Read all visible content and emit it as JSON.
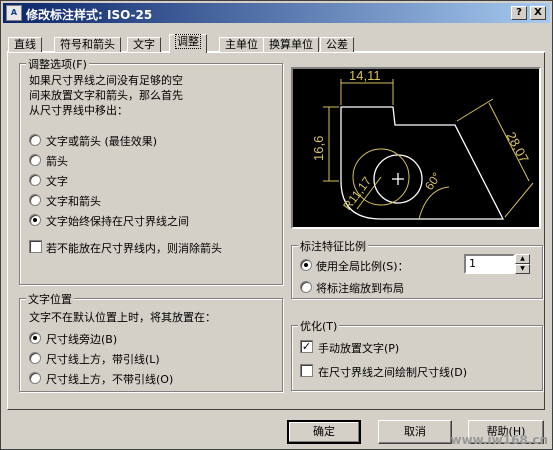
{
  "window": {
    "title": "修改标注样式: ISO-25",
    "help_btn": "?",
    "close_btn": "X",
    "icon_text": "A"
  },
  "tabs": [
    {
      "label": "直线"
    },
    {
      "label": "符号和箭头"
    },
    {
      "label": "文字"
    },
    {
      "label": "调整"
    },
    {
      "label": "主单位"
    },
    {
      "label": "换算单位"
    },
    {
      "label": "公差"
    }
  ],
  "fit_options": {
    "title": "调整选项(F)",
    "desc": [
      "如果尺寸界线之间没有足够的空",
      "间来放置文字和箭头，那么首先",
      "从尺寸界线中移出："
    ],
    "options": [
      {
        "label": "文字或箭头 (最佳效果)",
        "selected": false
      },
      {
        "label": "箭头",
        "selected": false
      },
      {
        "label": "文字",
        "selected": false
      },
      {
        "label": "文字和箭头",
        "selected": false
      },
      {
        "label": "文字始终保持在尺寸界线之间",
        "selected": true
      }
    ],
    "suppress_label": "若不能放在尺寸界线内，则消除箭头",
    "suppress_checked": false
  },
  "text_placement": {
    "title": "文字位置",
    "desc": "文字不在默认位置上时，将其放置在：",
    "options": [
      {
        "label": "尺寸线旁边(B)",
        "selected": true
      },
      {
        "label": "尺寸线上方，带引线(L)",
        "selected": false
      },
      {
        "label": "尺寸线上方，不带引线(O)",
        "selected": false
      }
    ]
  },
  "preview": {
    "labels": {
      "top_dim": "14,11",
      "left_dim": "16,6",
      "right_dim": "28,07",
      "radius": "R11,17",
      "angle": "60°"
    },
    "colors": {
      "background": "#000000",
      "geometry": "#ffffff",
      "dimension": "#d6c15a"
    }
  },
  "scale_features": {
    "title": "标注特征比例",
    "global_label": "使用全局比例(S)：",
    "global_selected": true,
    "global_value": "1",
    "layout_label": "将标注缩放到布局",
    "layout_selected": false
  },
  "fine_tuning": {
    "title": "优化(T)",
    "manual_text_label": "手动放置文字(P)",
    "manual_text_checked": true,
    "draw_dimline_label": "在尺寸界线之间绘制尺寸线(D)",
    "draw_dimline_checked": false
  },
  "buttons": {
    "ok": "确定",
    "cancel": "取消",
    "help": "帮助(H)"
  },
  "watermark": "www.iw168.cn"
}
